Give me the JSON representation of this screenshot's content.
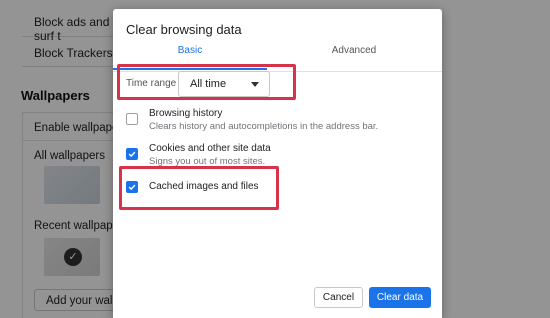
{
  "background": {
    "rows": [
      {
        "label": "Block ads and surf t"
      },
      {
        "label": "Block Trackers"
      }
    ],
    "wallpapers_heading": "Wallpapers",
    "enable_wallpapers_label": "Enable wallpapers",
    "all_wallpapers_label": "All wallpapers",
    "recent_wallpapers_label": "Recent wallpapers",
    "add_wallpaper_button": "Add your wallpa"
  },
  "dialog": {
    "title": "Clear browsing data",
    "tabs": [
      {
        "label": "Basic",
        "active": true
      },
      {
        "label": "Advanced",
        "active": false
      }
    ],
    "time_range": {
      "label": "Time range",
      "value": "All time"
    },
    "options": [
      {
        "title": "Browsing history",
        "description": "Clears history and autocompletions in the address bar.",
        "checked": false
      },
      {
        "title": "Cookies and other site data",
        "description": "Signs you out of most sites.",
        "checked": true
      },
      {
        "title": "Cached images and files",
        "description": "",
        "checked": true
      }
    ],
    "buttons": {
      "cancel": "Cancel",
      "clear": "Clear data"
    }
  },
  "colors": {
    "accent": "#1a73e8",
    "highlight": "#d6334a"
  },
  "icons": {
    "dropdown": "chevron-down-icon",
    "checkbox_checked": "checkmark-icon",
    "wallpaper_selected": "checkmark-circle-icon"
  }
}
